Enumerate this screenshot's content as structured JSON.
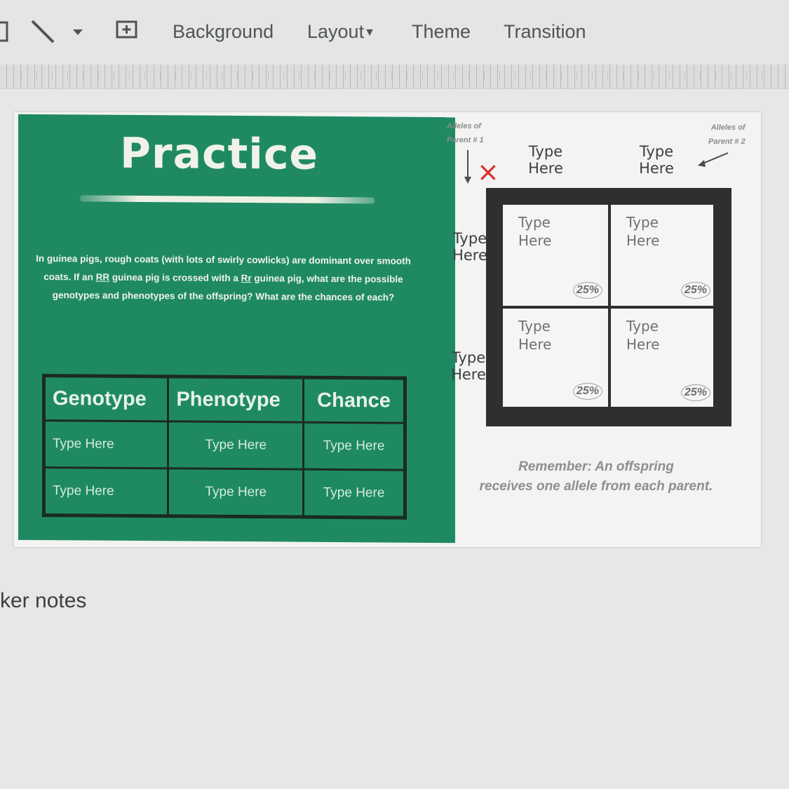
{
  "toolbar": {
    "items": [
      "Background",
      "Layout",
      "Theme",
      "Transition"
    ]
  },
  "slide": {
    "title": "Practice",
    "question_parts": [
      "In guinea pigs, rough coats (with lots of swirly cowlicks) are dominant over smooth coats. If an ",
      "RR",
      " guinea pig is crossed with a ",
      "Rr",
      " guinea pig, what are the possible genotypes and phenotypes of the offspring? What are the chances of each?"
    ],
    "table": {
      "headers": [
        "Genotype",
        "Phenotype",
        "Chance"
      ],
      "rows": [
        [
          "Type Here",
          "Type Here",
          "Type Here"
        ],
        [
          "Type Here",
          "Type Here",
          "Type Here"
        ]
      ]
    },
    "punnett": {
      "note_parent1": [
        "Alleles of",
        "Parent # 1"
      ],
      "note_parent2": [
        "Alleles of",
        "Parent # 2"
      ],
      "top_labels": [
        "Type\nHere",
        "Type\nHere"
      ],
      "side_labels": [
        "Type\nHere",
        "Type\nHere"
      ],
      "cells": [
        {
          "text": "Type\nHere",
          "pct": "25%"
        },
        {
          "text": "Type\nHere",
          "pct": "25%"
        },
        {
          "text": "Type\nHere",
          "pct": "25%"
        },
        {
          "text": "Type\nHere",
          "pct": "25%"
        }
      ],
      "cross_symbol": "×"
    },
    "remember": [
      "Remember: An offspring",
      "receives one allele from each parent."
    ]
  },
  "speaker_notes_label": "ker notes",
  "colors": {
    "slide_green": "#1f8a61",
    "cross_red": "#d9302c"
  }
}
